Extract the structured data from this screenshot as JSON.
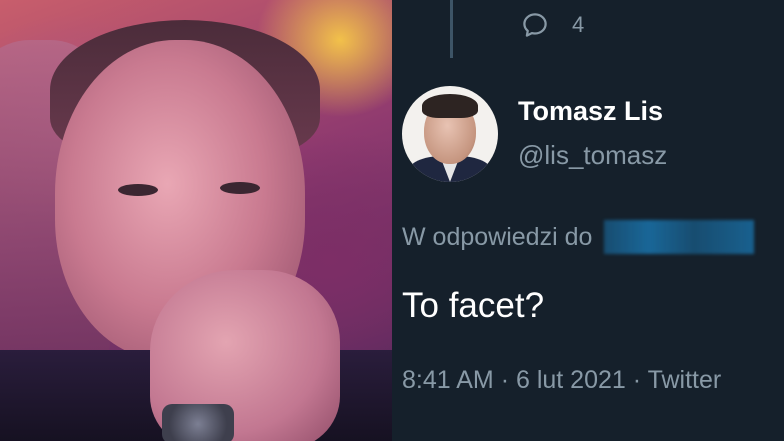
{
  "reply": {
    "count": "4"
  },
  "author": {
    "name": "Tomasz Lis",
    "handle": "@lis_tomasz"
  },
  "in_reply_to": {
    "label": "W odpowiedzi do"
  },
  "tweet": {
    "text": "To facet?"
  },
  "meta": {
    "time": "8:41 AM",
    "separator": "·",
    "date": "6 lut 2021",
    "source": "Twitter"
  },
  "colors": {
    "background": "#15202b",
    "secondary_text": "#8899a6",
    "link_blue": "#1da1f2"
  }
}
